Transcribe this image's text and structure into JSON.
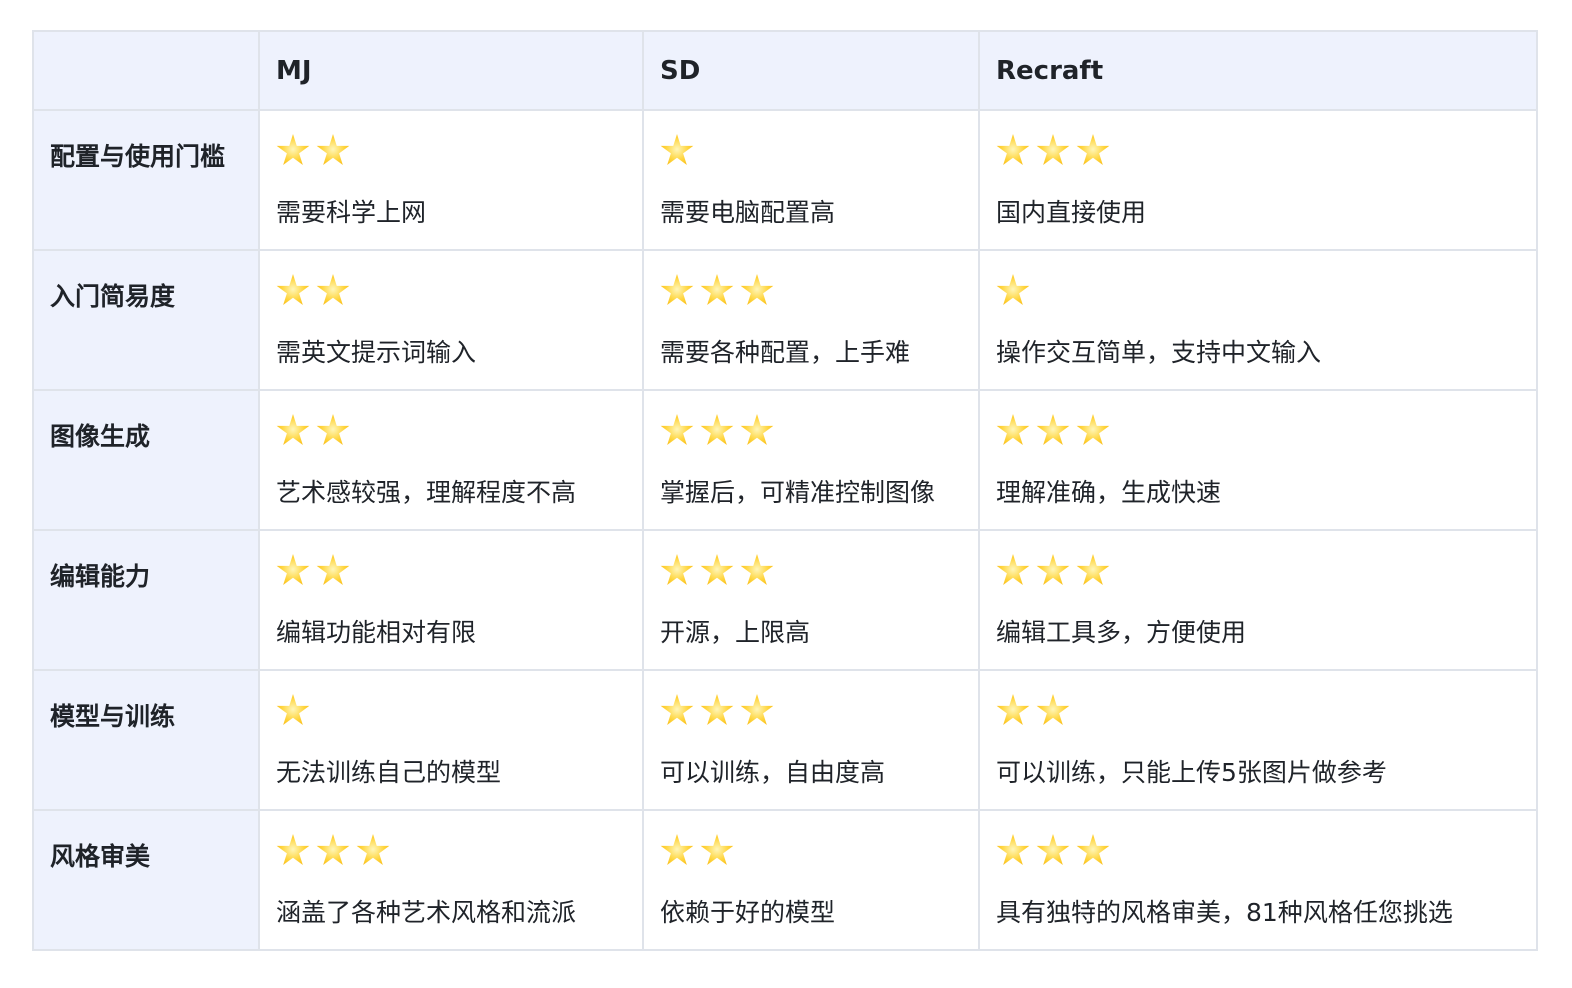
{
  "columns": [
    "",
    "MJ",
    "SD",
    "Recraft"
  ],
  "rows": [
    {
      "label": "配置与使用门槛",
      "cells": [
        {
          "stars": 2,
          "text": "需要科学上网"
        },
        {
          "stars": 1,
          "text": "需要电脑配置高"
        },
        {
          "stars": 3,
          "text": "国内直接使用"
        }
      ]
    },
    {
      "label": "入门简易度",
      "cells": [
        {
          "stars": 2,
          "text": "需英文提示词输入"
        },
        {
          "stars": 3,
          "text": "需要各种配置，上手难"
        },
        {
          "stars": 1,
          "text": "操作交互简单，支持中文输入"
        }
      ]
    },
    {
      "label": "图像生成",
      "cells": [
        {
          "stars": 2,
          "text": "艺术感较强，理解程度不高"
        },
        {
          "stars": 3,
          "text": "掌握后，可精准控制图像"
        },
        {
          "stars": 3,
          "text": "理解准确，生成快速"
        }
      ]
    },
    {
      "label": "编辑能力",
      "cells": [
        {
          "stars": 2,
          "text": "编辑功能相对有限"
        },
        {
          "stars": 3,
          "text": "开源，上限高"
        },
        {
          "stars": 3,
          "text": "编辑工具多，方便使用"
        }
      ]
    },
    {
      "label": "模型与训练",
      "cells": [
        {
          "stars": 1,
          "text": "无法训练自己的模型"
        },
        {
          "stars": 3,
          "text": "可以训练，自由度高"
        },
        {
          "stars": 2,
          "text": "可以训练，只能上传5张图片做参考"
        }
      ]
    },
    {
      "label": "风格审美",
      "cells": [
        {
          "stars": 3,
          "text": "涵盖了各种艺术风格和流派"
        },
        {
          "stars": 2,
          "text": "依赖于好的模型"
        },
        {
          "stars": 3,
          "text": "具有独特的风格审美，81种风格任您挑选"
        }
      ]
    }
  ],
  "icons": {
    "rating": "star-icon"
  },
  "colors": {
    "header_bg": "#eef2fd",
    "border": "#dfe3ea",
    "star": "#ffd43b"
  }
}
